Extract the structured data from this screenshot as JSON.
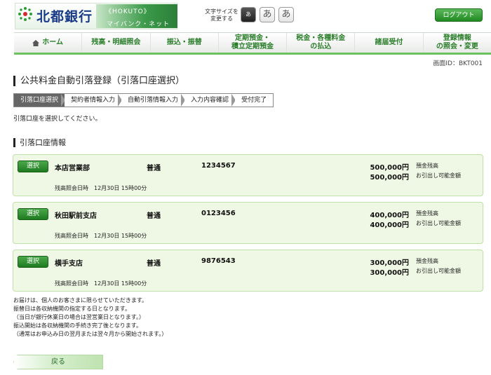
{
  "header": {
    "bank_name": "北都銀行",
    "logo_hokuto": "《HOKUTO》",
    "logo_sub": "マイバンク・ネット",
    "font_size_label": "文字サイズを変更する",
    "font_size_buttons": [
      "あ",
      "あ",
      "あ"
    ],
    "logout_label": "ログアウト"
  },
  "nav": {
    "items": [
      {
        "label": "ホーム"
      },
      {
        "label": "残高・明細照会"
      },
      {
        "label": "振込・振替"
      },
      {
        "label": "定期預金・\n積立定期預金"
      },
      {
        "label": "税金・各種料金\nの払込"
      },
      {
        "label": "諸届受付"
      },
      {
        "label": "登録情報\nの照会・変更"
      }
    ]
  },
  "screen_id": "画面ID：BKT001",
  "page_title": "公共料金自動引落登録（引落口座選択）",
  "steps": [
    "引落口座選択",
    "契約者情報入力",
    "自動引落情報入力",
    "入力内容確認",
    "受付完了"
  ],
  "instruction": "引落口座を選択してください。",
  "section_title": "引落口座情報",
  "accounts": [
    {
      "select_label": "選択",
      "branch": "本店営業部",
      "type": "普通",
      "number": "1234567",
      "balance": "500,000円",
      "balance_label": "預金残高",
      "available": "500,000円",
      "available_label": "お引出し可能金額",
      "inquiry": "残高照会日時　12月30日 15時00分"
    },
    {
      "select_label": "選択",
      "branch": "秋田駅前支店",
      "type": "普通",
      "number": "0123456",
      "balance": "400,000円",
      "balance_label": "預金残高",
      "available": "400,000円",
      "available_label": "お引出し可能金額",
      "inquiry": "残高照会日時　12月30日 15時00分"
    },
    {
      "select_label": "選択",
      "branch": "横手支店",
      "type": "普通",
      "number": "9876543",
      "balance": "300,000円",
      "balance_label": "預金残高",
      "available": "300,000円",
      "available_label": "お引出し可能金額",
      "inquiry": "残高照会日時　12月30日 15時00分"
    }
  ],
  "notes": [
    "お届けは、個人のお客さまに限らせていただきます。",
    "振替日は各収納機関の指定する日となります。",
    "（当日が銀行休業日の場合は翌営業日となります。）",
    "振込開始は各収納機関の手続き完了後となります。",
    "（通常はお申込み日の翌月または翌々月から開始されます。）"
  ],
  "back_label": "戻る",
  "colors": {
    "brand_green": "#2a7e2a",
    "card_bg": "#eef8e4",
    "nav_underline": "#6dc25f"
  }
}
